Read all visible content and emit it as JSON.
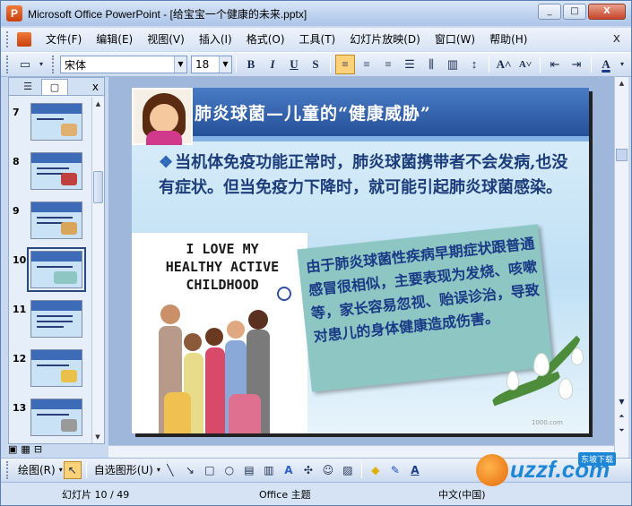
{
  "window": {
    "title": "Microsoft Office PowerPoint - [给宝宝一个健康的未来.pptx]",
    "controls": [
      "_",
      "□",
      "X"
    ]
  },
  "menu": {
    "items": [
      "文件(F)",
      "编辑(E)",
      "视图(V)",
      "插入(I)",
      "格式(O)",
      "工具(T)",
      "幻灯片放映(D)",
      "窗口(W)",
      "帮助(H)"
    ],
    "close": "x"
  },
  "format_toolbar": {
    "font_name": "宋体",
    "font_size": "18",
    "bold": "B",
    "italic": "I",
    "underline": "U",
    "shadow": "S"
  },
  "panel": {
    "close": "x",
    "thumbnails": [
      {
        "num": "7"
      },
      {
        "num": "8"
      },
      {
        "num": "9"
      },
      {
        "num": "10"
      },
      {
        "num": "11"
      },
      {
        "num": "12"
      },
      {
        "num": "13"
      }
    ],
    "selected": "10"
  },
  "slide": {
    "title": "肺炎球菌—儿童的“健康威胁”",
    "bullet_mark": "❖",
    "bullet_text": "当机体免疫功能正常时，肺炎球菌携带者不会发病,也没有症状。但当免疫力下降时，就可能引起肺炎球菌感染。",
    "photo_text": "I LOVE MY HEALTHY ACTIVE CHILDHOOD",
    "callout_text": "由于肺炎球菌性疾病早期症状跟普通感冒很相似，主要表现为发烧、咳嗽等，家长容易忽视、贻误诊治，导致对患儿的身体健康造成伤害。",
    "watermark_small": "1000.com"
  },
  "draw_toolbar": {
    "draw_label": "绘图(R)",
    "autoshape_label": "自选图形(U)"
  },
  "status": {
    "slide_pos": "幻灯片 10 / 49",
    "theme": "Office 主题",
    "language": "中文(中国)"
  },
  "watermark": {
    "text": "uzzf.com",
    "badge": "东坡下载"
  }
}
